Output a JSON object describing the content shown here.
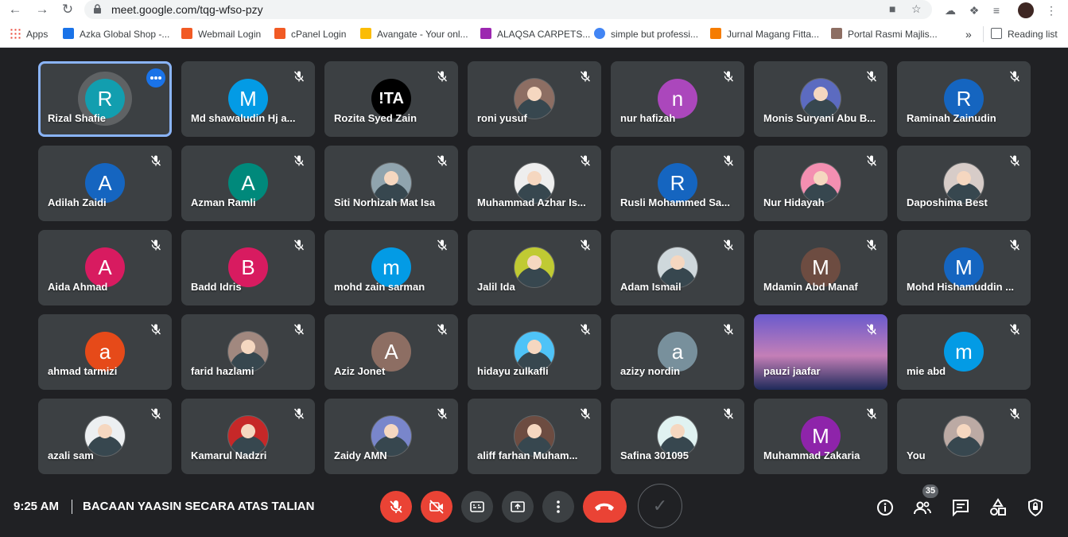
{
  "browser": {
    "url": "meet.google.com/tqg-wfso-pzy",
    "bookmarks": [
      {
        "label": "Apps",
        "color": "#ea4335"
      },
      {
        "label": "Azka Global Shop -...",
        "color": "#1a73e8"
      },
      {
        "label": "Webmail Login",
        "color": "#f15a24"
      },
      {
        "label": "cPanel Login",
        "color": "#f15a24"
      },
      {
        "label": "Avangate - Your onl...",
        "color": "#fbbc04"
      },
      {
        "label": "ALAQSA CARPETS...",
        "color": "#9c27b0"
      },
      {
        "label": "simple but professi...",
        "color": "#4285f4"
      },
      {
        "label": "Jurnal Magang Fitta...",
        "color": "#f57c00"
      },
      {
        "label": "Portal Rasmi Majlis...",
        "color": "#8d6e63"
      }
    ],
    "overflow": "»",
    "reading_list": "Reading list"
  },
  "participants": [
    {
      "name": "Rizal Shafie",
      "initial": "R",
      "color": "#129eaf",
      "active": true
    },
    {
      "name": "Md shawaludin Hj a...",
      "initial": "M",
      "color": "#039be5"
    },
    {
      "name": "Rozita Syed Zain",
      "initial": "!TA",
      "color": "#000000"
    },
    {
      "name": "roni yusuf",
      "initial": "",
      "color": "#8d6e63",
      "photo": true
    },
    {
      "name": "nur hafizah",
      "initial": "n",
      "color": "#ab47bc"
    },
    {
      "name": "Monis Suryani Abu B...",
      "initial": "",
      "color": "#5c6bc0",
      "photo": true
    },
    {
      "name": "Raminah Zainudin",
      "initial": "R",
      "color": "#1565c0"
    },
    {
      "name": "Adilah Zaidi",
      "initial": "A",
      "color": "#1565c0"
    },
    {
      "name": "Azman Ramli",
      "initial": "A",
      "color": "#00897b"
    },
    {
      "name": "Siti Norhizah Mat Isa",
      "initial": "",
      "color": "#90a4ae",
      "photo": true
    },
    {
      "name": "Muhammad Azhar Is...",
      "initial": "",
      "color": "#eeeeee",
      "photo": true
    },
    {
      "name": "Rusli Mohammed Sa...",
      "initial": "R",
      "color": "#1565c0"
    },
    {
      "name": "Nur Hidayah",
      "initial": "",
      "color": "#f48fb1",
      "photo": true
    },
    {
      "name": "Daposhima Best",
      "initial": "",
      "color": "#d7ccc8",
      "photo": true
    },
    {
      "name": "Aida Ahmad",
      "initial": "A",
      "color": "#d81b60"
    },
    {
      "name": "Badd Idris",
      "initial": "B",
      "color": "#d81b60"
    },
    {
      "name": "mohd zain sarman",
      "initial": "m",
      "color": "#039be5"
    },
    {
      "name": "Jalil Ida",
      "initial": "",
      "color": "#c0ca33",
      "photo": true
    },
    {
      "name": "Adam Ismail",
      "initial": "",
      "color": "#cfd8dc",
      "photo": true
    },
    {
      "name": "Mdamin Abd Manaf",
      "initial": "M",
      "color": "#6d4c41"
    },
    {
      "name": "Mohd Hishamuddin ...",
      "initial": "M",
      "color": "#1565c0"
    },
    {
      "name": "ahmad tarmizi",
      "initial": "a",
      "color": "#e64a19"
    },
    {
      "name": "farid hazlami",
      "initial": "",
      "color": "#a1887f",
      "photo": true
    },
    {
      "name": "Aziz Jonet",
      "initial": "A",
      "color": "#8d6e63"
    },
    {
      "name": "hidayu zulkafli",
      "initial": "",
      "color": "#4fc3f7",
      "photo": true
    },
    {
      "name": "azizy nordin",
      "initial": "a",
      "color": "#78909c"
    },
    {
      "name": "pauzi jaafar",
      "initial": "",
      "color": "#5c6bc0",
      "video": true
    },
    {
      "name": "mie abd",
      "initial": "m",
      "color": "#039be5"
    },
    {
      "name": "azali sam",
      "initial": "",
      "color": "#eceff1",
      "photo": true
    },
    {
      "name": "Kamarul Nadzri",
      "initial": "",
      "color": "#c62828",
      "photo": true
    },
    {
      "name": "Zaidy AMN",
      "initial": "",
      "color": "#7986cb",
      "photo": true
    },
    {
      "name": "aliff farhan Muham...",
      "initial": "",
      "color": "#6d4c41",
      "photo": true
    },
    {
      "name": "Safina 301095",
      "initial": "",
      "color": "#e0f2f1",
      "photo": true
    },
    {
      "name": "Muhammad Zakaria",
      "initial": "M",
      "color": "#8e24aa"
    },
    {
      "name": "You",
      "initial": "",
      "color": "#bcaaa4",
      "photo": true
    }
  ],
  "meeting": {
    "time": "9:25 AM",
    "title": "BACAAN YAASIN SECARA ATAS TALIAN",
    "participant_count": "35",
    "check_mark": "✓"
  },
  "colors": {
    "accent": "#8ab4f8",
    "danger": "#ea4335",
    "tile_bg": "#3c4043",
    "bg": "#202124"
  }
}
